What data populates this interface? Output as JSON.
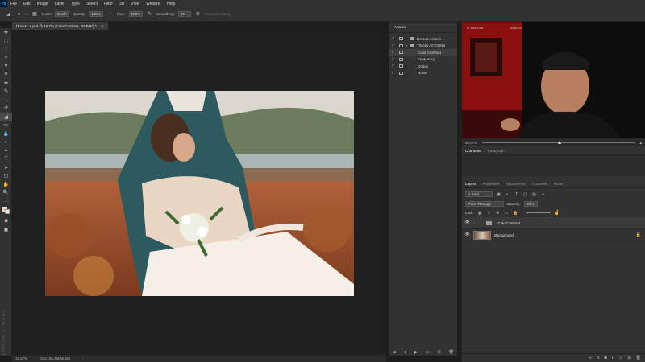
{
  "menubar": {
    "logo": "Ps",
    "items": [
      "File",
      "Edit",
      "Image",
      "Layer",
      "Type",
      "Select",
      "Filter",
      "3D",
      "View",
      "Window",
      "Help"
    ]
  },
  "options": {
    "brush_size": "1",
    "mode_label": "Mode:",
    "mode_value": "Brush",
    "opacity_label": "Opacity:",
    "opacity_value": "100%",
    "flow_label": "Flow:",
    "flow_value": "100%",
    "smoothing_label": "Smoothing:",
    "smoothing_value": "0%",
    "erase_history": "Erase to History"
  },
  "document": {
    "tab_title": "Проект 1.psd @ 16,7% (ColorContrast, RGB/8*) *",
    "zoom": "16,67%",
    "doc_info": "Doc: 56,2M/56,2M"
  },
  "watermark": "ZEROA STUDIO",
  "actions": {
    "title": "Actions",
    "items": [
      {
        "label": "Default Actions",
        "type": "set",
        "checked": true,
        "expanded": false,
        "selected": false
      },
      {
        "label": "TWAIN ACTIONS",
        "type": "set",
        "checked": true,
        "expanded": true,
        "selected": false
      },
      {
        "label": "Color Contrast",
        "type": "action",
        "checked": true,
        "expanded": false,
        "selected": true
      },
      {
        "label": "Frequency",
        "type": "action",
        "checked": true,
        "expanded": false,
        "selected": false
      },
      {
        "label": "Dodge",
        "type": "action",
        "checked": true,
        "expanded": false,
        "selected": false
      },
      {
        "label": "Noise",
        "type": "action",
        "checked": true,
        "expanded": false,
        "selected": false
      }
    ]
  },
  "webcam": {
    "overlay_text": "⊕ ZAROTA",
    "overlay_tag": "twainpro",
    "zoom": "66,67%"
  },
  "character": {
    "tabs": [
      "Character",
      "Paragraph"
    ]
  },
  "layers_panel": {
    "tabs": [
      "Layers",
      "Properties",
      "Adjustments",
      "Channels",
      "Paths"
    ],
    "filter_kind": "Kind",
    "blend_mode": "Pass Through",
    "opacity_label": "Opacity:",
    "opacity_value": "25%",
    "lock_label": "Lock:",
    "layers": [
      {
        "name": "ColorContrast",
        "type": "group",
        "visible": true,
        "selected": true
      },
      {
        "name": "Background",
        "type": "image",
        "visible": true,
        "selected": false,
        "locked": true
      }
    ]
  },
  "colors": {
    "foreground": "#f3c48d",
    "background": "#eeeeee",
    "accent_red": "#e0221a"
  }
}
